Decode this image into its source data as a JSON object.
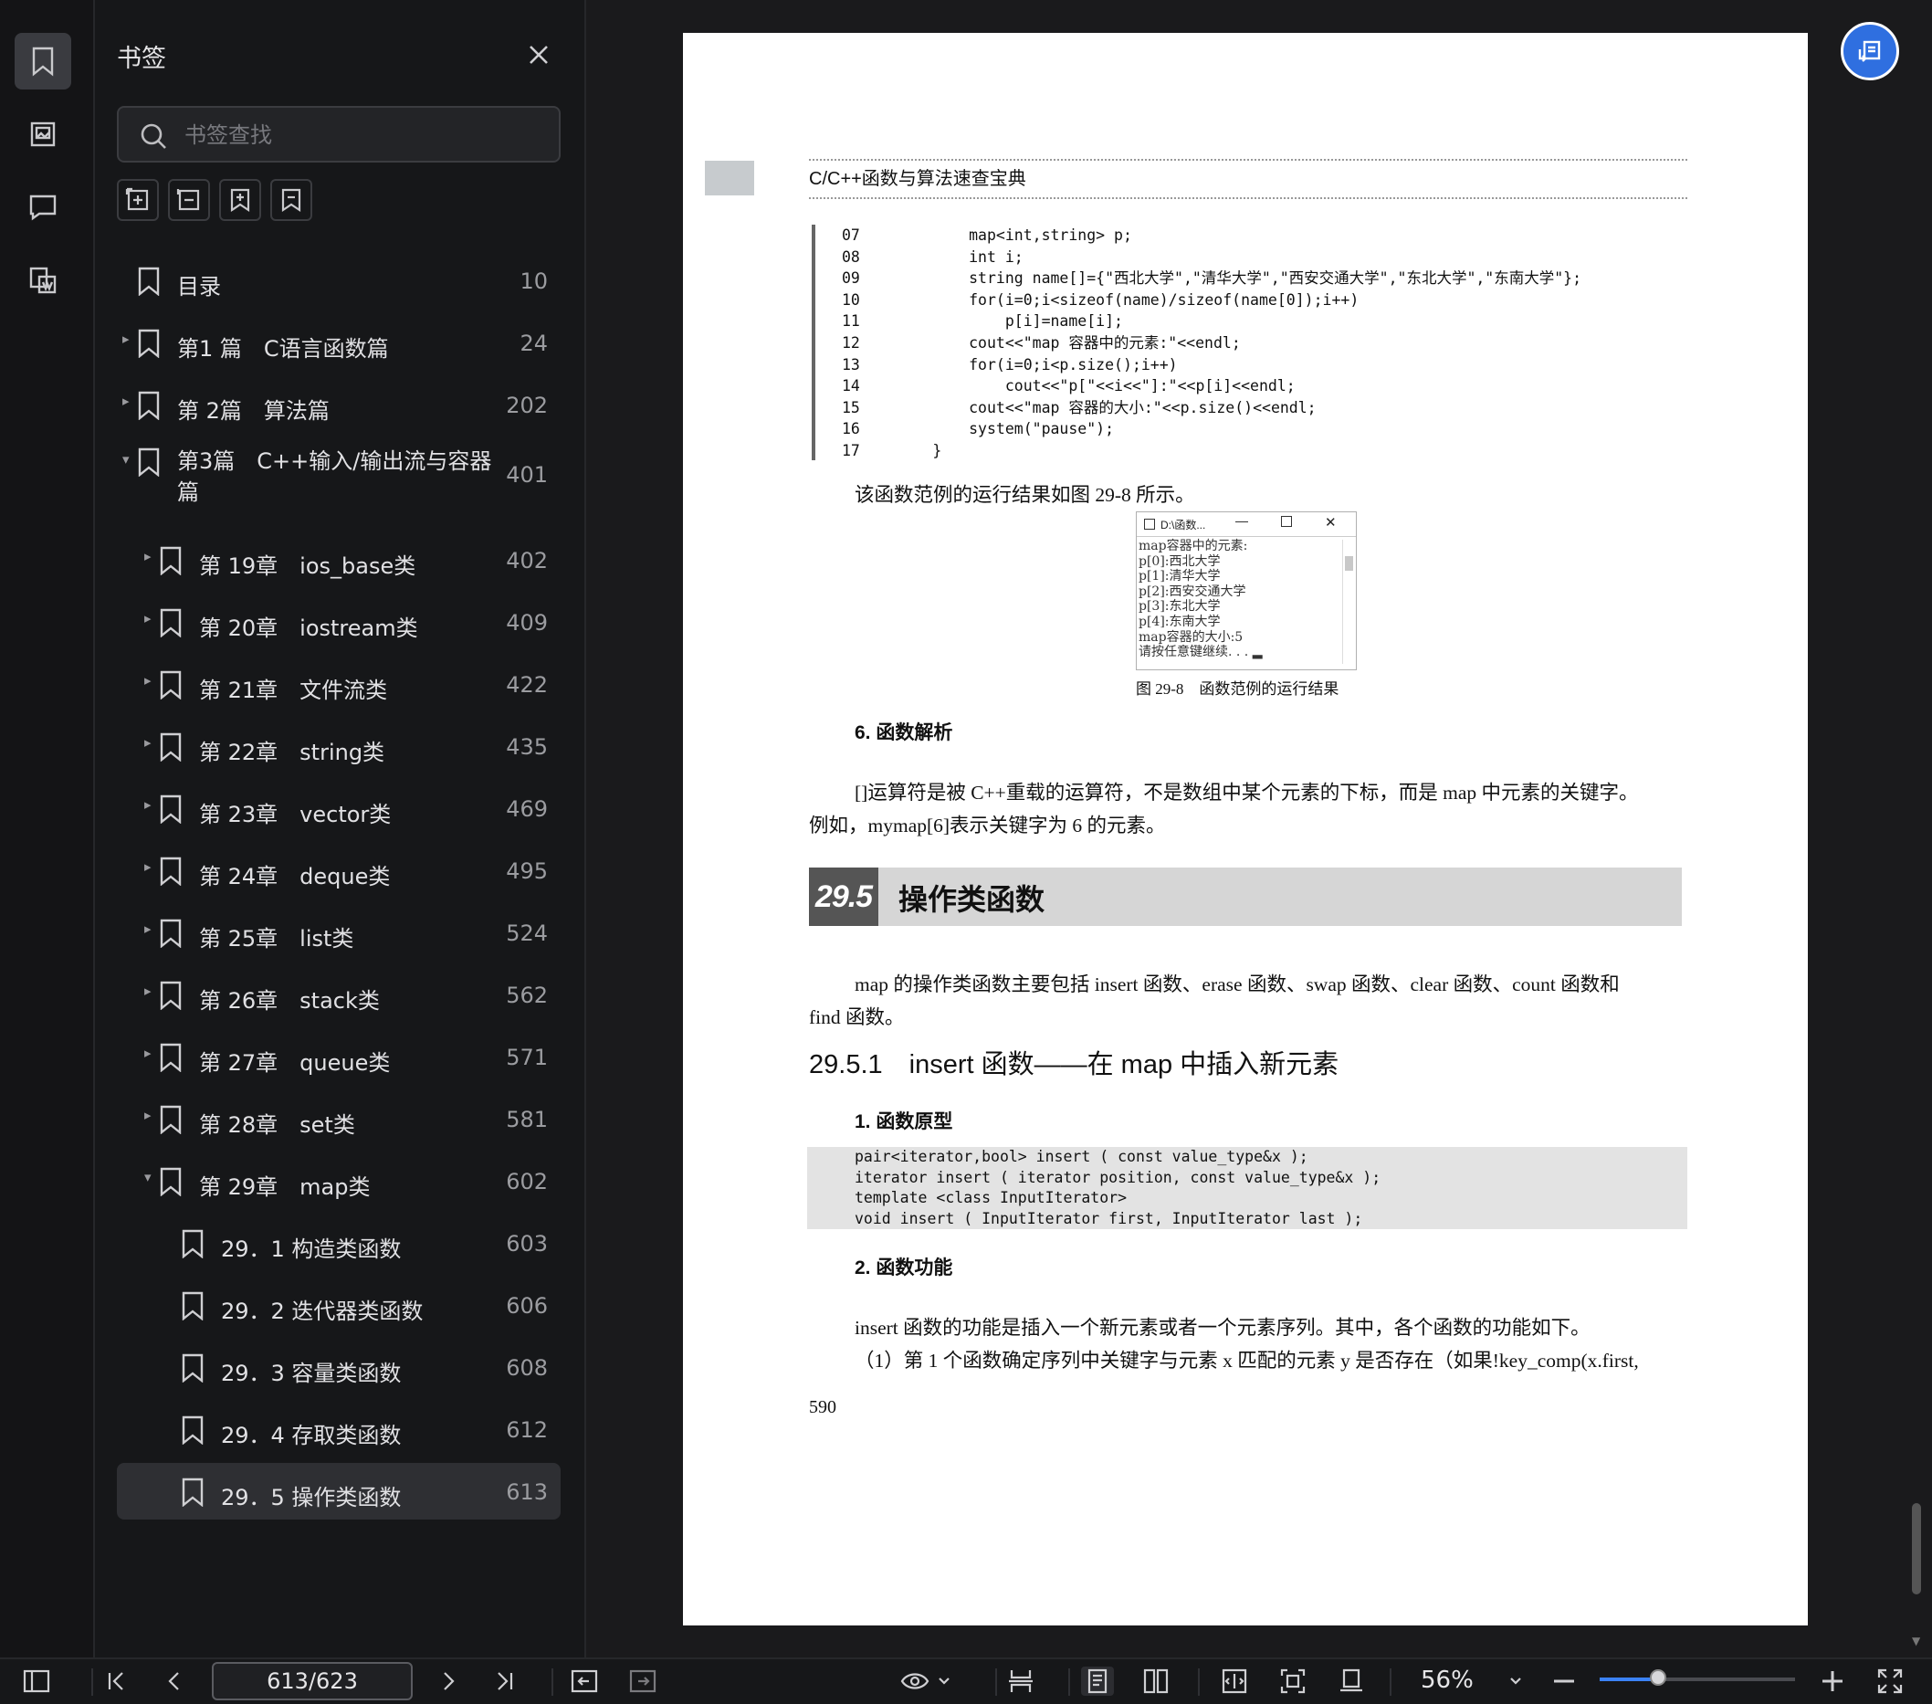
{
  "rail": {
    "icons": [
      "bookmark-icon",
      "image-icon",
      "comment-icon",
      "extract-icon"
    ]
  },
  "panel": {
    "title": "书签",
    "search_placeholder": "书签查找",
    "items": [
      {
        "label": "目录",
        "page": "10",
        "level": 0,
        "arrow": ""
      },
      {
        "label": "第1 篇　C语言函数篇",
        "page": "24",
        "level": 0,
        "arrow": "▸"
      },
      {
        "label": "第 2篇　算法篇",
        "page": "202",
        "level": 0,
        "arrow": "▸"
      },
      {
        "label": "第3篇　C++输入/输出流与容器篇",
        "page": "401",
        "level": 0,
        "arrow": "▾"
      },
      {
        "label": "第 19章　ios_base类",
        "page": "402",
        "level": 1,
        "arrow": "▸"
      },
      {
        "label": "第 20章　iostream类",
        "page": "409",
        "level": 1,
        "arrow": "▸"
      },
      {
        "label": "第 21章　文件流类",
        "page": "422",
        "level": 1,
        "arrow": "▸"
      },
      {
        "label": "第 22章　string类",
        "page": "435",
        "level": 1,
        "arrow": "▸"
      },
      {
        "label": "第 23章　vector类",
        "page": "469",
        "level": 1,
        "arrow": "▸"
      },
      {
        "label": "第 24章　deque类",
        "page": "495",
        "level": 1,
        "arrow": "▸"
      },
      {
        "label": "第 25章　list类",
        "page": "524",
        "level": 1,
        "arrow": "▸"
      },
      {
        "label": "第 26章　stack类",
        "page": "562",
        "level": 1,
        "arrow": "▸"
      },
      {
        "label": "第 27章　queue类",
        "page": "571",
        "level": 1,
        "arrow": "▸"
      },
      {
        "label": "第 28章　set类",
        "page": "581",
        "level": 1,
        "arrow": "▸"
      },
      {
        "label": "第 29章　map类",
        "page": "602",
        "level": 1,
        "arrow": "▾"
      },
      {
        "label": "29．1 构造类函数",
        "page": "603",
        "level": 2,
        "arrow": ""
      },
      {
        "label": "29．2 迭代器类函数",
        "page": "606",
        "level": 2,
        "arrow": ""
      },
      {
        "label": "29．3 容量类函数",
        "page": "608",
        "level": 2,
        "arrow": ""
      },
      {
        "label": "29．4 存取类函数",
        "page": "612",
        "level": 2,
        "arrow": ""
      },
      {
        "label": "29．5 操作类函数",
        "page": "613",
        "level": 2,
        "arrow": "",
        "selected": true
      }
    ]
  },
  "doc": {
    "running_head": "C/C++函数与算法速查宝典",
    "code_lines": [
      {
        "n": "07",
        "t": "        map<int,string> p;"
      },
      {
        "n": "08",
        "t": "        int i;"
      },
      {
        "n": "09",
        "t": "        string name[]={\"西北大学\",\"清华大学\",\"西安交通大学\",\"东北大学\",\"东南大学\"};"
      },
      {
        "n": "10",
        "t": "        for(i=0;i<sizeof(name)/sizeof(name[0]);i++)"
      },
      {
        "n": "11",
        "t": "            p[i]=name[i];"
      },
      {
        "n": "12",
        "t": "        cout<<\"map 容器中的元素:\"<<endl;"
      },
      {
        "n": "13",
        "t": "        for(i=0;i<p.size();i++)"
      },
      {
        "n": "14",
        "t": "            cout<<\"p[\"<<i<<\"]:\"<<p[i]<<endl;"
      },
      {
        "n": "15",
        "t": "        cout<<\"map 容器的大小:\"<<p.size()<<endl;"
      },
      {
        "n": "16",
        "t": "        system(\"pause\");"
      },
      {
        "n": "17",
        "t": "    }"
      }
    ],
    "run_result_intro": "该函数范例的运行结果如图 29-8 所示。",
    "terminal": {
      "title": "D:\\函数...",
      "lines": [
        "map容器中的元素:",
        "p[0]:西北大学",
        "p[1]:清华大学",
        "p[2]:西安交通大学",
        "p[3]:东北大学",
        "p[4]:东南大学",
        "map容器的大小:5",
        "请按任意键继续. . . ▂"
      ]
    },
    "figure_caption": "图 29-8　函数范例的运行结果",
    "analysis_heading": "6.  函数解析",
    "analysis_text_1": "[]运算符是被 C++重载的运算符，不是数组中某个元素的下标，而是 map 中元素的关键字。",
    "analysis_text_2": "例如，mymap[6]表示关键字为 6 的元素。",
    "section_number": "29.5",
    "section_title": "操作类函数",
    "section_intro_1": "map 的操作类函数主要包括 insert 函数、erase 函数、swap 函数、clear 函数、count 函数和",
    "section_intro_2": "find 函数。",
    "subsection": "29.5.1　insert 函数——在 map 中插入新元素",
    "proto_heading": "1.  函数原型",
    "prototypes": [
      "pair<iterator,bool> insert ( const value_type&x );",
      "iterator insert ( iterator position, const value_type&x );",
      "template <class InputIterator>",
      "void insert ( InputIterator first, InputIterator last );"
    ],
    "func_heading": "2.  函数功能",
    "func_text_1": "insert 函数的功能是插入一个新元素或者一个元素序列。其中，各个函数的功能如下。",
    "func_text_2": "（1）第 1 个函数确定序列中关键字与元素 x 匹配的元素 y 是否存在（如果!key_comp(x.first,",
    "page_number": "590"
  },
  "toolbar": {
    "page_indicator": "613/623",
    "zoom": "56%",
    "zoom_level": 0.3
  }
}
